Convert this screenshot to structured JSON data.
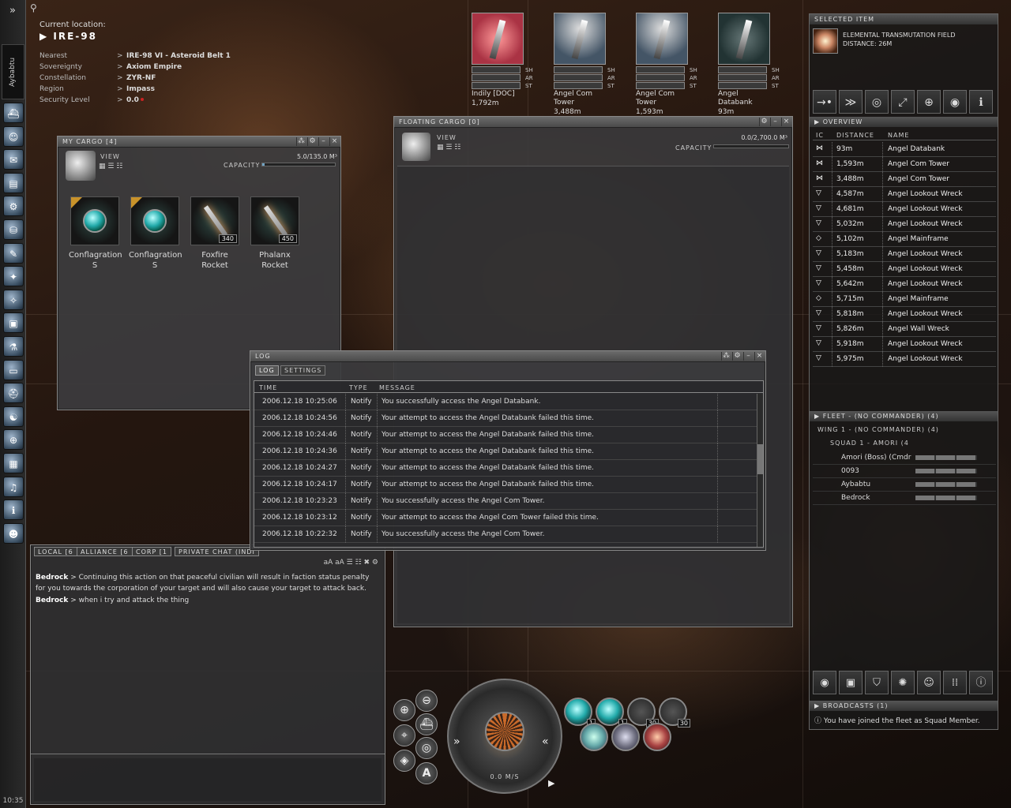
{
  "neocom": {
    "expand_glyph": "»",
    "character_tab": "Aybabtu",
    "clock": "10:35",
    "buttons": [
      "ship-icon",
      "people-icon",
      "mail-icon",
      "notepad-icon",
      "assets-icon",
      "market-icon",
      "journal-icon",
      "map-icon",
      "starmap-icon",
      "items-icon",
      "science-icon",
      "wallet-icon",
      "help-icon",
      "corp-icon",
      "browser-icon",
      "book-icon",
      "audio-icon",
      "info-icon",
      "character-icon"
    ]
  },
  "location": {
    "current_label": "Current location:",
    "system": "IRE-98",
    "rows": [
      {
        "key": "Nearest",
        "value": "IRE-98 VI - Asteroid Belt 1"
      },
      {
        "key": "Sovereignty",
        "value": "Axiom Empire"
      },
      {
        "key": "Constellation",
        "value": "ZYR-NF"
      },
      {
        "key": "Region",
        "value": "Impass"
      },
      {
        "key": "Security Level",
        "value": "0.0"
      }
    ]
  },
  "my_cargo": {
    "title": "MY CARGO [4]",
    "view_label": "VIEW",
    "capacity_label": "CAPACITY",
    "capacity_value": "5.0/135.0 M³",
    "capacity_fraction": 0.037,
    "items": [
      {
        "name": "Conflagration S",
        "qty": "",
        "kind": "crystal"
      },
      {
        "name": "Conflagration S",
        "qty": "",
        "kind": "crystal"
      },
      {
        "name": "Foxfire Rocket",
        "qty": "340",
        "kind": "rocket"
      },
      {
        "name": "Phalanx Rocket",
        "qty": "450",
        "kind": "rocket"
      }
    ]
  },
  "floating_cargo": {
    "title": "FLOATING CARGO [0]",
    "view_label": "VIEW",
    "capacity_label": "CAPACITY",
    "capacity_value": "0.0/2,700.0 M³",
    "capacity_fraction": 0.0
  },
  "targets": [
    {
      "name": "Indily [DOC]",
      "distance": "1,792m"
    },
    {
      "name": "Angel Com Tower",
      "distance": "3,488m"
    },
    {
      "name": "Angel Com Tower",
      "distance": "1,593m"
    },
    {
      "name": "Angel Databank",
      "distance": "93m"
    }
  ],
  "target_bar_labels": [
    "SH",
    "AR",
    "ST"
  ],
  "selected_item": {
    "header": "SELECTED ITEM",
    "name": "ELEMENTAL TRANSMUTATION FIELD",
    "distance": "DISTANCE: 26M",
    "action_icons": [
      "approach-icon",
      "warp-icon",
      "orbit-icon",
      "keep-range-icon",
      "lock-target-icon",
      "look-at-icon",
      "show-info-icon"
    ]
  },
  "overview": {
    "header": "OVERVIEW",
    "columns": [
      "IC",
      "DISTANCE",
      "NAME"
    ],
    "rows": [
      {
        "icon": "⋈",
        "distance": "93m",
        "name": "Angel Databank"
      },
      {
        "icon": "⋈",
        "distance": "1,593m",
        "name": "Angel Com Tower"
      },
      {
        "icon": "⋈",
        "distance": "3,488m",
        "name": "Angel Com Tower"
      },
      {
        "icon": "▽",
        "distance": "4,587m",
        "name": "Angel Lookout Wreck"
      },
      {
        "icon": "▽",
        "distance": "4,681m",
        "name": "Angel Lookout Wreck"
      },
      {
        "icon": "▽",
        "distance": "5,032m",
        "name": "Angel Lookout Wreck"
      },
      {
        "icon": "◇",
        "distance": "5,102m",
        "name": "Angel Mainframe"
      },
      {
        "icon": "▽",
        "distance": "5,183m",
        "name": "Angel Lookout Wreck"
      },
      {
        "icon": "▽",
        "distance": "5,458m",
        "name": "Angel Lookout Wreck"
      },
      {
        "icon": "▽",
        "distance": "5,642m",
        "name": "Angel Lookout Wreck"
      },
      {
        "icon": "◇",
        "distance": "5,715m",
        "name": "Angel Mainframe"
      },
      {
        "icon": "▽",
        "distance": "5,818m",
        "name": "Angel Lookout Wreck"
      },
      {
        "icon": "▽",
        "distance": "5,826m",
        "name": "Angel Wall Wreck"
      },
      {
        "icon": "▽",
        "distance": "5,918m",
        "name": "Angel Lookout Wreck"
      },
      {
        "icon": "▽",
        "distance": "5,975m",
        "name": "Angel Lookout Wreck"
      }
    ]
  },
  "fleet": {
    "header": "FLEET - (NO COMMANDER) (4)",
    "wing": "WING 1 - (NO COMMANDER) (4)",
    "squad": "SQUAD 1 - AMORI (4",
    "members": [
      "Amori (Boss) (Cmdr",
      "0093",
      "Aybabtu",
      "Bedrock"
    ]
  },
  "bottom_buttons": [
    "eye-icon",
    "cargo-icon",
    "shield-icon",
    "radar-icon",
    "person-icon",
    "dots-icon",
    "info-circle-icon"
  ],
  "broadcasts": {
    "header": "BROADCASTS (1)",
    "message": "You have joined the fleet as Squad Member."
  },
  "log": {
    "title": "LOG",
    "tabs": [
      "LOG",
      "SETTINGS"
    ],
    "columns": [
      "TIME",
      "TYPE",
      "MESSAGE"
    ],
    "rows": [
      {
        "time": "2006.12.18 10:25:06",
        "type": "Notify",
        "message": "You successfully access the Angel Databank."
      },
      {
        "time": "2006.12.18 10:24:56",
        "type": "Notify",
        "message": "Your attempt to access the Angel Databank failed this time."
      },
      {
        "time": "2006.12.18 10:24:46",
        "type": "Notify",
        "message": "Your attempt to access the Angel Databank failed this time."
      },
      {
        "time": "2006.12.18 10:24:36",
        "type": "Notify",
        "message": "Your attempt to access the Angel Databank failed this time."
      },
      {
        "time": "2006.12.18 10:24:27",
        "type": "Notify",
        "message": "Your attempt to access the Angel Databank failed this time."
      },
      {
        "time": "2006.12.18 10:24:17",
        "type": "Notify",
        "message": "Your attempt to access the Angel Databank failed this time."
      },
      {
        "time": "2006.12.18 10:23:23",
        "type": "Notify",
        "message": "You successfully access the Angel Com Tower."
      },
      {
        "time": "2006.12.18 10:23:12",
        "type": "Notify",
        "message": "Your attempt to access the Angel Com Tower failed this time."
      },
      {
        "time": "2006.12.18 10:22:32",
        "type": "Notify",
        "message": "You successfully access the Angel Com Tower."
      }
    ]
  },
  "chat": {
    "tabs": [
      "LOCAL [6",
      "ALLIANCE [6",
      "CORP [1",
      "PRIVATE CHAT (INDI"
    ],
    "messages": [
      {
        "sender": "Bedrock",
        "text": "> Continuing this action on that peaceful civilian will result in faction status penalty for you towards the corporation of your target and will also cause your target to attack back."
      },
      {
        "sender": "Bedrock",
        "text": "> when i try and attack the thing"
      }
    ]
  },
  "hud": {
    "speed": "0.0 M/S",
    "modules": [
      {
        "qty": "1"
      },
      {
        "qty": "1"
      },
      {
        "qty": "30"
      },
      {
        "qty": "30"
      }
    ],
    "side_buttons": [
      "zoom-in-icon",
      "zoom-out-icon",
      "tactical-icon",
      "autopilot-icon",
      "camera-icon",
      "scanner-icon"
    ],
    "autopilot_label": "A"
  },
  "colors": {
    "accent": "#6fa2c4",
    "security": "#c22",
    "panel": "#3c3c3e"
  }
}
